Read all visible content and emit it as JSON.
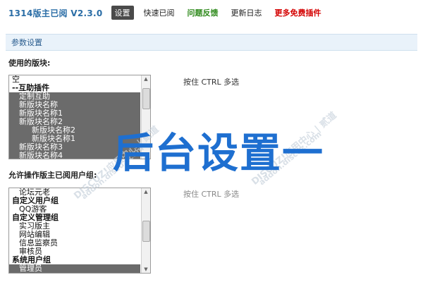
{
  "app": {
    "title": "1314版主已阅 V2.3.0"
  },
  "nav": {
    "settings": "设置",
    "quick_read": "快速已阅",
    "feedback": "问题反馈",
    "changelog": "更新日志",
    "more_plugins": "更多免费插件"
  },
  "section": {
    "title": "参数设置"
  },
  "forums_field": {
    "label": "使用的版块:",
    "hint": "按住 CTRL 多选",
    "options": [
      "空",
      "--互助插件",
      "定制互助",
      "新版块名称",
      "新版块名称1",
      "新版块名称2",
      "新版块名称2",
      "新版块名称1",
      "新版块名称3",
      "新版块名称4"
    ]
  },
  "groups_field": {
    "label": "允许操作版主已阅用户组:",
    "hint": "按住 CTRL 多选",
    "options": [
      "论坛元老",
      "自定义用户组",
      "QQ游客",
      "自定义管理组",
      "实习版主",
      "网站编辑",
      "信息监察员",
      "审核员",
      "系统用户组",
      "管理员"
    ]
  },
  "overlay": {
    "text": "后台设置一"
  },
  "watermarks": [
    "DISCUZ!应用中心 | 贰道",
    "addon.discuz.com",
    "DISCUZ!应用中心 | 贰道",
    "addon.discuz.com"
  ],
  "colors": {
    "accent": "#2a6da6",
    "overlay": "#1e6fd0",
    "active_nav": "#4a4a4a",
    "feedback": "#2f8a1c",
    "more": "#d40000"
  }
}
